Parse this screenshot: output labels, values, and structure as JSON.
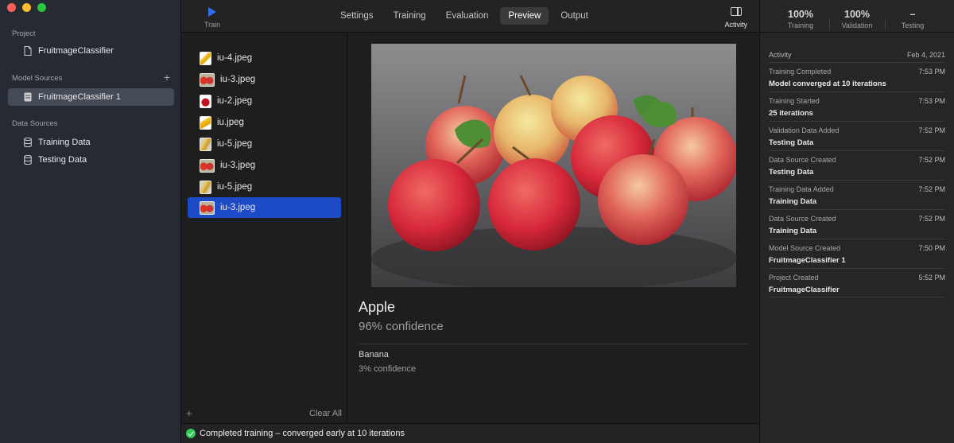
{
  "window": {
    "traffic_lights": [
      "#ff5f57",
      "#febc2e",
      "#28c840"
    ]
  },
  "sidebar": {
    "project_title": "Project",
    "project_name": "FruitmageClassifier",
    "model_sources_title": "Model Sources",
    "add_icon": "+",
    "model_source": "FruitmageClassifier 1",
    "data_sources_title": "Data Sources",
    "data_sources": [
      "Training Data",
      "Testing Data"
    ]
  },
  "toolbar": {
    "train_label": "Train",
    "tabs": [
      "Settings",
      "Training",
      "Evaluation",
      "Preview",
      "Output"
    ],
    "active_tab": "Preview",
    "activity_label": "Activity",
    "accent": "#2f6ef0"
  },
  "files": {
    "items": [
      "iu-4.jpeg",
      "iu-3.jpeg",
      "iu-2.jpeg",
      "iu.jpeg",
      "iu-5.jpeg",
      "iu-3.jpeg",
      "iu-5.jpeg",
      "iu-3.jpeg"
    ],
    "selected_index": 7,
    "add_icon": "+",
    "clear_label": "Clear All",
    "selection_color": "#1d4ac6"
  },
  "preview": {
    "prediction": "Apple",
    "confidence": "96% confidence",
    "second_prediction": "Banana",
    "second_confidence": "3% confidence"
  },
  "status": {
    "text": "Completed training – converged early at 10 iterations",
    "color": "#34c759"
  },
  "metrics": [
    {
      "value": "100%",
      "label": "Training"
    },
    {
      "value": "100%",
      "label": "Validation"
    },
    {
      "value": "–",
      "label": "Testing"
    }
  ],
  "activity": {
    "title": "Activity",
    "date": "Feb 4, 2021",
    "events": [
      {
        "event": "Training Completed",
        "time": "7:53 PM",
        "subject": "Model converged at 10 iterations"
      },
      {
        "event": "Training Started",
        "time": "7:53 PM",
        "subject": "25 iterations"
      },
      {
        "event": "Validation Data Added",
        "time": "7:52 PM",
        "subject": "Testing Data"
      },
      {
        "event": "Data Source Created",
        "time": "7:52 PM",
        "subject": "Testing Data"
      },
      {
        "event": "Training Data Added",
        "time": "7:52 PM",
        "subject": "Training Data"
      },
      {
        "event": "Data Source Created",
        "time": "7:52 PM",
        "subject": "Training Data"
      },
      {
        "event": "Model Source Created",
        "time": "7:50 PM",
        "subject": "FruitmageClassifier 1"
      },
      {
        "event": "Project Created",
        "time": "5:52 PM",
        "subject": "FruitmageClassifier"
      }
    ]
  }
}
